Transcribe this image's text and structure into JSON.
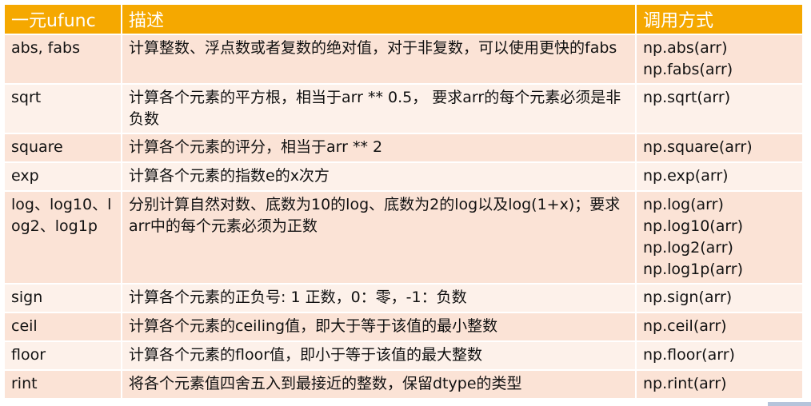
{
  "table": {
    "headers": [
      "一元ufunc",
      "描述",
      "调用方式"
    ],
    "rows": [
      {
        "name": "abs, fabs",
        "desc": "计算整数、浮点数或者复数的绝对值，对于非复数，可以使用更快的fabs",
        "calls": [
          "np.abs(arr)",
          "np.fabs(arr)"
        ]
      },
      {
        "name": "sqrt",
        "desc": "计算各个元素的平方根，相当于arr ** 0.5， 要求arr的每个元素必须是非负数",
        "calls": [
          "np.sqrt(arr)"
        ]
      },
      {
        "name": "square",
        "desc": "计算各个元素的评分，相当于arr ** 2",
        "calls": [
          "np.square(arr)"
        ]
      },
      {
        "name": "exp",
        "desc": "计算各个元素的指数e的x次方",
        "calls": [
          "np.exp(arr)"
        ]
      },
      {
        "name": "log、log10、log2、log1p",
        "desc": "分别计算自然对数、底数为10的log、底数为2的log以及log(1+x)；要求arr中的每个元素必须为正数",
        "calls": [
          "np.log(arr)",
          "np.log10(arr)",
          "np.log2(arr)",
          "np.log1p(arr)"
        ]
      },
      {
        "name": "sign",
        "desc": "计算各个元素的正负号: 1 正数，0：零，-1：负数",
        "calls": [
          "np.sign(arr)"
        ]
      },
      {
        "name": "ceil",
        "desc": "计算各个元素的ceiling值，即大于等于该值的最小整数",
        "calls": [
          "np.ceil(arr)"
        ]
      },
      {
        "name": "floor",
        "desc": "计算各个元素的floor值，即小于等于该值的最大整数",
        "calls": [
          "np.floor(arr)"
        ]
      },
      {
        "name": "rint",
        "desc": "将各个元素值四舍五入到最接近的整数，保留dtype的类型",
        "calls": [
          "np.rint(arr)"
        ]
      }
    ]
  },
  "colors": {
    "header_bg": "#f5a800",
    "row_odd_bg": "#fbe3d6",
    "row_even_bg": "#fdf1ea"
  }
}
